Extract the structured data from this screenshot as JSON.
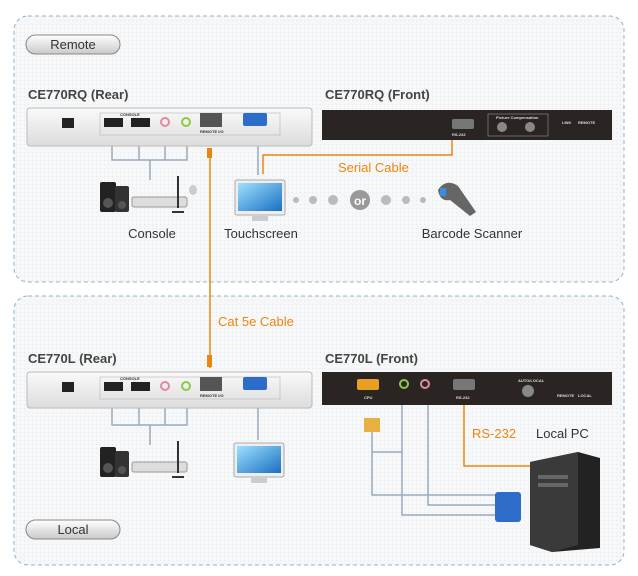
{
  "sections": {
    "remote": "Remote",
    "local": "Local"
  },
  "devices": {
    "rq_rear": "CE770RQ (Rear)",
    "rq_front": "CE770RQ (Front)",
    "l_rear": "CE770L (Rear)",
    "l_front": "CE770L (Front)"
  },
  "port_labels": {
    "console": "CONSOLE",
    "remote_io": "REMOTE I/O",
    "picture_comp": "Picture Compensation",
    "link": "LINK",
    "remote": "REMOTE",
    "local": "LOCAL",
    "rs232": "RS-232",
    "cpu": "CPU",
    "auto_local": "AUTO/LOCAL"
  },
  "labels": {
    "console": "Console",
    "touchscreen": "Touchscreen",
    "or": "or",
    "barcode": "Barcode Scanner",
    "serial_cable": "Serial Cable",
    "cat5e": "Cat 5e Cable",
    "rs232": "RS-232",
    "local_pc": "Local PC"
  },
  "colors": {
    "cable_orange": "#e8870f",
    "cable_gray": "#9ab",
    "panel_border": "#8fb4cc",
    "front_panel": "#2a2522"
  }
}
